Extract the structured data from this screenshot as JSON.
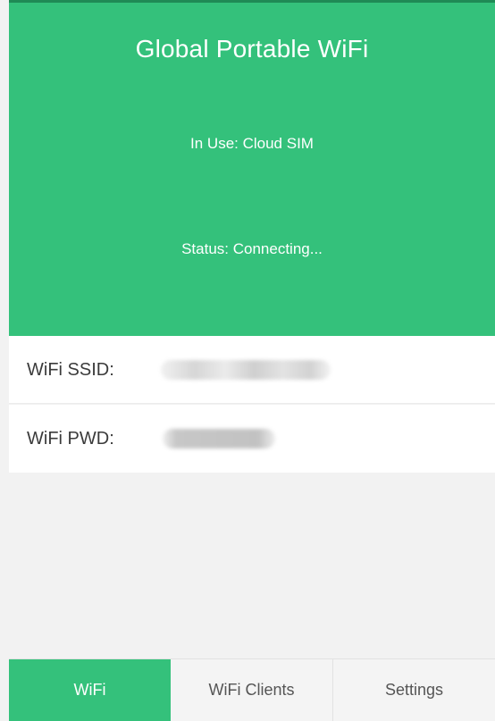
{
  "header": {
    "title": "Global Portable WiFi",
    "in_use": "In Use: Cloud SIM",
    "status": "Status: Connecting..."
  },
  "info": {
    "ssid_label": "WiFi SSID:",
    "pwd_label": "WiFi PWD:"
  },
  "tabs": [
    {
      "label": "WiFi",
      "active": true
    },
    {
      "label": "WiFi Clients",
      "active": false
    },
    {
      "label": "Settings",
      "active": false
    }
  ],
  "colors": {
    "accent": "#34c17b",
    "background": "#f2f2f2"
  }
}
